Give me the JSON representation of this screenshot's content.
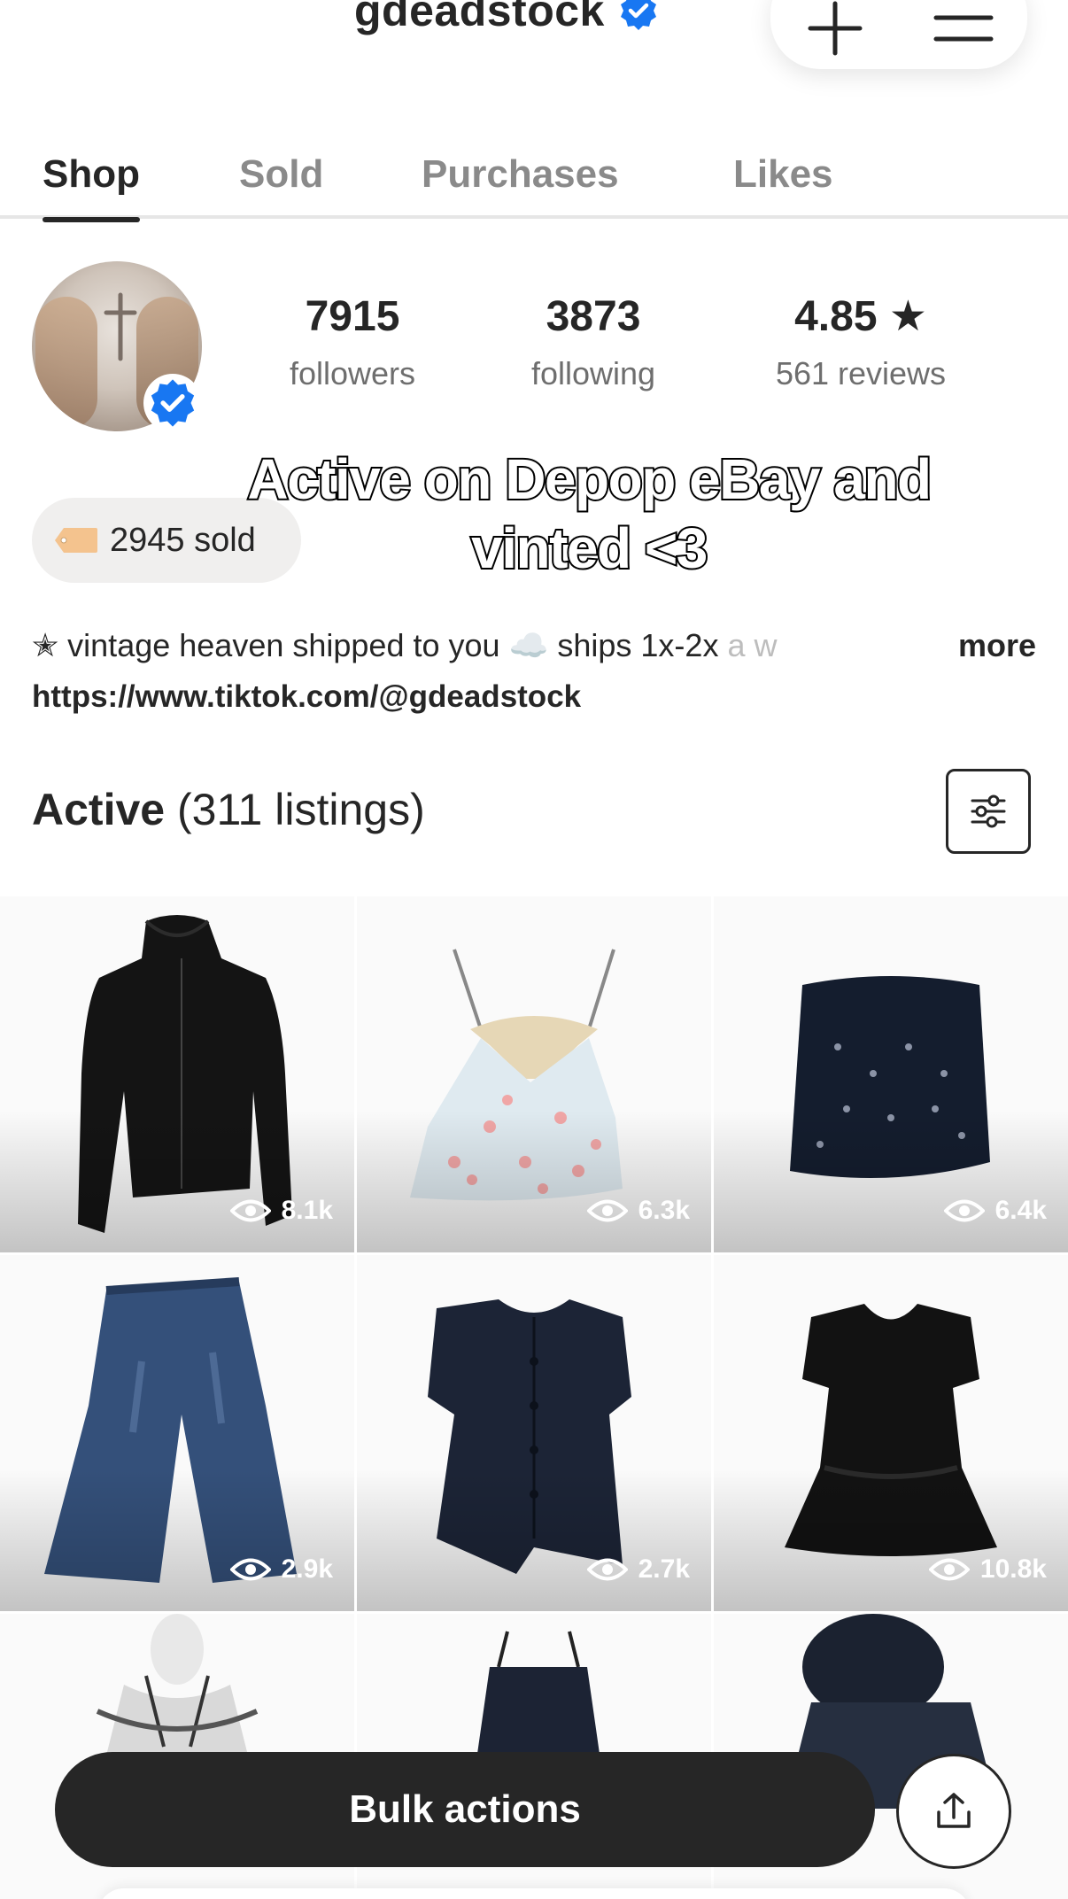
{
  "header": {
    "username": "gdeadstock",
    "add_icon": "plus-icon",
    "menu_icon": "hamburger-menu-icon",
    "verified_icon": "verified-badge-icon",
    "brand_blue": "#1877f2"
  },
  "tabs": [
    {
      "label": "Shop",
      "active": true
    },
    {
      "label": "Sold",
      "active": false
    },
    {
      "label": "Purchases",
      "active": false
    },
    {
      "label": "Likes",
      "active": false
    }
  ],
  "profile": {
    "followers_count": "7915",
    "followers_label": "followers",
    "following_count": "3873",
    "following_label": "following",
    "rating": "4.85 ★",
    "reviews_label": "561 reviews",
    "sold_label": "2945 sold",
    "overlay_caption": "Active on Depop eBay and vinted <3",
    "bio_main": "✭ vintage heaven shipped to you ☁️ ships 1x-2x ",
    "bio_fade": "a w",
    "more_label": "more",
    "link": "https://www.tiktok.com/@gdeadstock"
  },
  "listings": {
    "title": "Active",
    "count_label": "(311 listings)",
    "filter_icon": "sliders-filter-icon",
    "items": [
      {
        "name": "black zip hoodie",
        "views": "8.1k"
      },
      {
        "name": "strawberry lace cami",
        "views": "6.3k"
      },
      {
        "name": "navy knit tube top",
        "views": "6.4k"
      },
      {
        "name": "flared jeans",
        "views": "2.9k"
      },
      {
        "name": "navy ruffle blouse",
        "views": "2.7k"
      },
      {
        "name": "black knit dress top",
        "views": "10.8k"
      },
      {
        "name": "white halter top",
        "views": ""
      },
      {
        "name": "navy cami",
        "views": ""
      },
      {
        "name": "fur hood jacket",
        "views": ""
      }
    ]
  },
  "footer": {
    "bulk_label": "Bulk actions",
    "share_icon": "share-upload-icon"
  }
}
